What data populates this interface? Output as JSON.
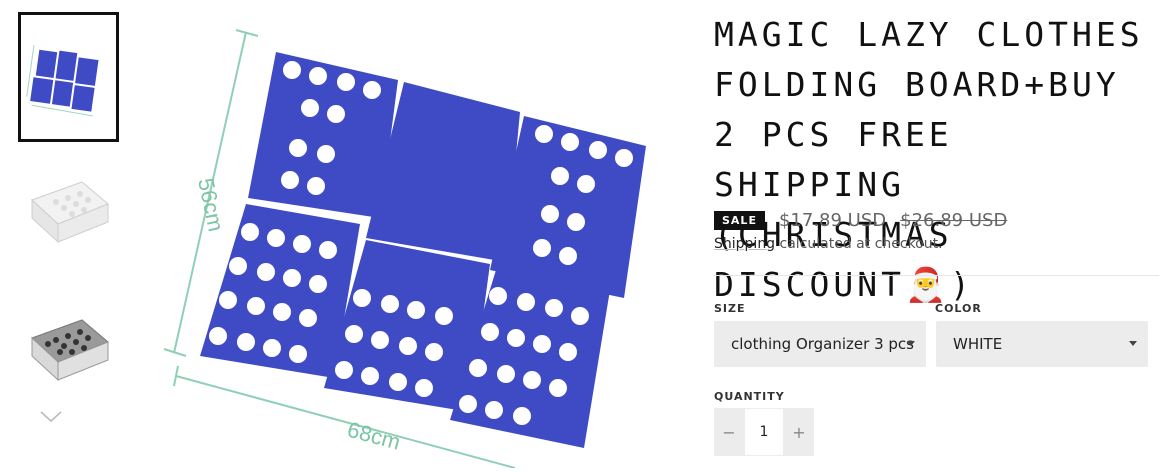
{
  "product": {
    "title": "MAGIC LAZY CLOTHES FOLDING BOARD+BUY 2 PCS FREE SHIPPING (CHRISTMAS DISCOUNT🎅)",
    "sale_badge": "SALE",
    "price": "$17.89 USD",
    "compare_price": "$26.89 USD",
    "shipping_link": "Shipping",
    "shipping_text": " calculated at checkout."
  },
  "options": {
    "size_label": "SIZE",
    "size_value": "clothing Organizer 3 pcs",
    "color_label": "COLOR",
    "color_value": "WHITE",
    "quantity_label": "QUANTITY",
    "quantity_value": "1",
    "minus": "−",
    "plus": "+"
  },
  "image": {
    "height_label": "56cm",
    "width_label": "68cm"
  },
  "colors": {
    "board": "#3f4bc4",
    "board_dark": "#2f3aa8",
    "dimension": "#8fd0b4"
  }
}
